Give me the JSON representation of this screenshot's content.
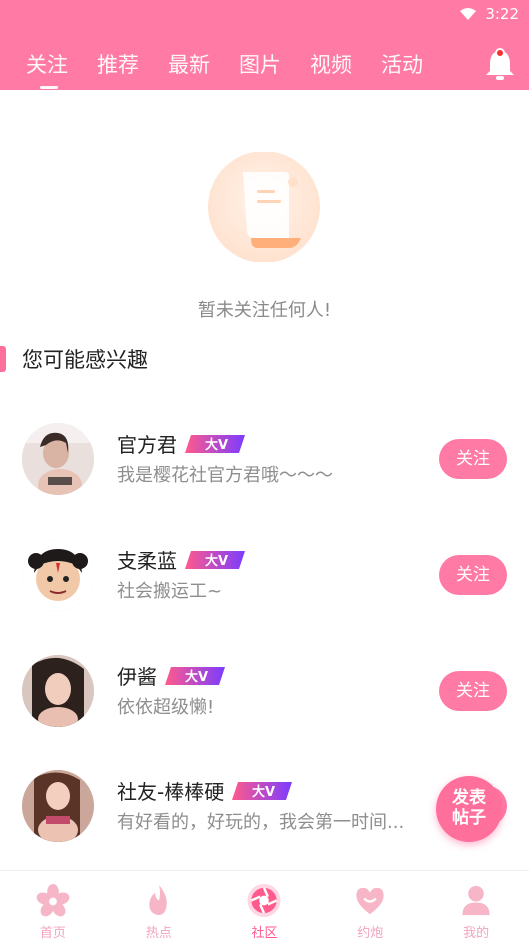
{
  "status": {
    "time": "3:22"
  },
  "tabs": [
    {
      "label": "关注"
    },
    {
      "label": "推荐"
    },
    {
      "label": "最新"
    },
    {
      "label": "图片"
    },
    {
      "label": "视频"
    },
    {
      "label": "活动"
    }
  ],
  "empty": {
    "text": "暂未关注任何人!"
  },
  "section": {
    "title": "您可能感兴趣"
  },
  "users": [
    {
      "name": "官方君",
      "bio": "我是樱花社官方君哦～～～",
      "badge": "大V",
      "follow": "关注"
    },
    {
      "name": "支柔蓝",
      "bio": "社会搬运工~",
      "badge": "大V",
      "follow": "关注"
    },
    {
      "name": "伊酱",
      "bio": "依依超级懒!",
      "badge": "大V",
      "follow": "关注"
    },
    {
      "name": "社友-棒棒硬",
      "bio": "有好看的，好玩的，我会第一时间...",
      "badge": "大V",
      "follow": "关注"
    }
  ],
  "fab": {
    "line1": "发表",
    "line2": "帖子"
  },
  "bottomnav": [
    {
      "label": "首页",
      "icon": "sakura-icon"
    },
    {
      "label": "热点",
      "icon": "flame-icon"
    },
    {
      "label": "社区",
      "icon": "aperture-icon",
      "active": true
    },
    {
      "label": "约炮",
      "icon": "heart-icon"
    },
    {
      "label": "我的",
      "icon": "person-icon"
    }
  ],
  "colors": {
    "primary": "#ff7aa5",
    "accent": "#ff6f9c",
    "badge": "#7b3cff"
  }
}
